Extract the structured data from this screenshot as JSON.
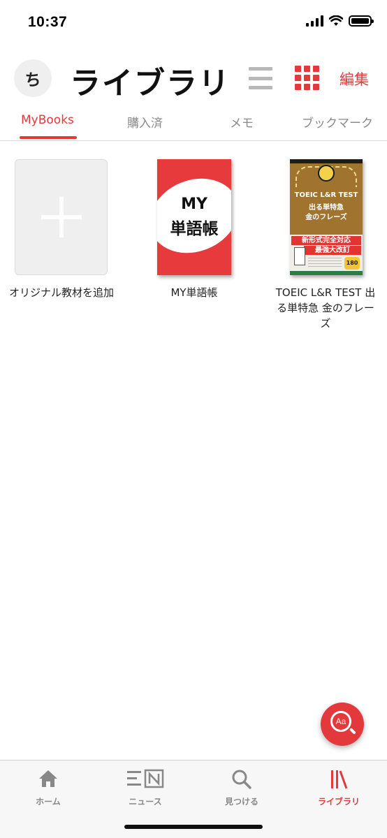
{
  "status_bar": {
    "time": "10:37"
  },
  "header": {
    "avatar_initial": "ち",
    "title": "ライブラリ",
    "edit_label": "編集"
  },
  "tabs": [
    {
      "label": "MyBooks",
      "active": true
    },
    {
      "label": "購入済",
      "active": false
    },
    {
      "label": "メモ",
      "active": false
    },
    {
      "label": "ブックマーク",
      "active": false
    }
  ],
  "books": [
    {
      "title": "オリジナル教材を追加",
      "cover": "add"
    },
    {
      "title": "MY単語帳",
      "cover_text_line1": "MY",
      "cover_text_line2": "単語帳"
    },
    {
      "title": "TOEIC L&R TEST 出る単特急 金のフレーズ",
      "cover_text_line1": "TOEIC L&R TEST",
      "cover_text_line2": "出る単特急",
      "cover_text_line3": "金のフレーズ",
      "cover_banner1": "新形式完全対応",
      "cover_banner2": "最強大改訂",
      "cover_badge": "180"
    }
  ],
  "fab": {
    "label": "Aa",
    "icon": "dictionary-search-icon"
  },
  "bottom_nav": [
    {
      "label": "ホーム",
      "icon": "home-icon",
      "active": false
    },
    {
      "label": "ニュース",
      "icon": "news-icon",
      "active": false
    },
    {
      "label": "見つける",
      "icon": "search-icon",
      "active": false
    },
    {
      "label": "ライブラリ",
      "icon": "library-icon",
      "active": true
    }
  ],
  "colors": {
    "accent": "#e4393c",
    "inactive": "#888888"
  }
}
